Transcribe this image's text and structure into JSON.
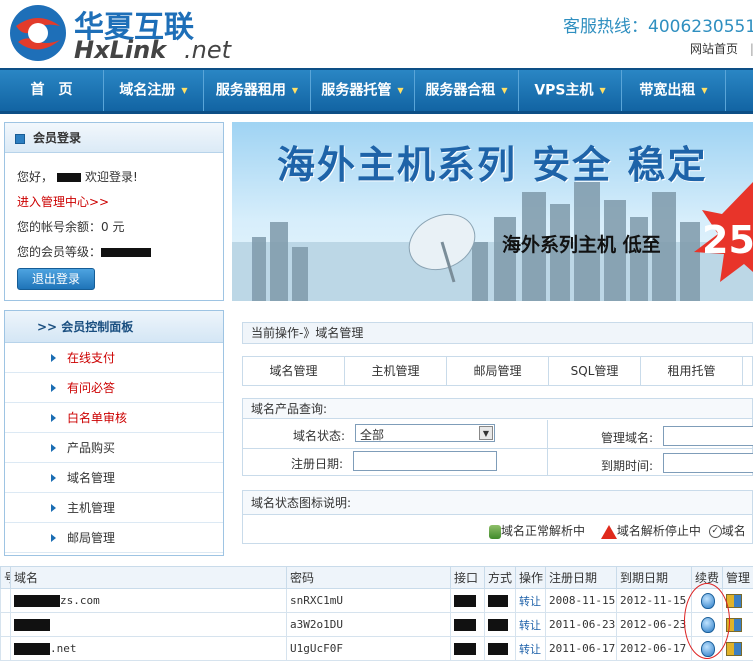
{
  "header": {
    "logo_cn": "华夏互联",
    "logo_en": "HxLink",
    "logo_tld": ".net",
    "hotline_label": "客服热线：4006230551",
    "hotline_tail": "(",
    "top_link": "网站首页",
    "top_sep": "|"
  },
  "nav": [
    {
      "label": "首　页",
      "dropdown": false
    },
    {
      "label": "域名注册",
      "dropdown": true
    },
    {
      "label": "服务器租用",
      "dropdown": true
    },
    {
      "label": "服务器托管",
      "dropdown": true
    },
    {
      "label": "服务器合租",
      "dropdown": true
    },
    {
      "label": "VPS主机",
      "dropdown": true
    },
    {
      "label": "带宽出租",
      "dropdown": true
    }
  ],
  "login": {
    "title": "会员登录",
    "greeting_prefix": "您好，",
    "greeting_suffix": "欢迎登录!",
    "manage_link": "进入管理中心>>",
    "balance": "您的帐号余额：0 元",
    "level_label": "您的会员等级：",
    "logout_button": "退出登录"
  },
  "banner": {
    "headline": "海外主机系列 安全 稳定",
    "subline": "海外系列主机 低至",
    "price": "25"
  },
  "panel": {
    "title": ">> 会员控制面板",
    "items": [
      {
        "label": "在线支付",
        "highlight": true
      },
      {
        "label": "有问必答",
        "highlight": true
      },
      {
        "label": "白名单审核",
        "highlight": true
      },
      {
        "label": "产品购买",
        "highlight": false
      },
      {
        "label": "域名管理",
        "highlight": false
      },
      {
        "label": "主机管理",
        "highlight": false
      },
      {
        "label": "邮局管理",
        "highlight": false
      }
    ]
  },
  "breadcrumb": "当前操作-》域名管理",
  "tabs": [
    "域名管理",
    "主机管理",
    "邮局管理",
    "SQL管理",
    "租用托管"
  ],
  "query": {
    "title": "域名产品查询:",
    "status_label": "域名状态:",
    "status_value": "全部",
    "manage_domain_label": "管理域名:",
    "reg_date_label": "注册日期:",
    "expire_label": "到期时间:"
  },
  "legend": {
    "title": "域名状态图标说明:",
    "items": [
      "域名正常解析中",
      "域名解析停止中",
      "域名"
    ]
  },
  "table": {
    "headers": [
      "号",
      "域名",
      "密码",
      "接口",
      "方式",
      "操作",
      "注册日期",
      "到期日期",
      "续费",
      "管理"
    ],
    "rows": [
      {
        "domain_suffix": "zs.com",
        "password": "snRXC1mU",
        "op": "转让",
        "reg": "2008-11-15",
        "exp": "2012-11-15"
      },
      {
        "domain_suffix": "",
        "password": "a3W2o1DU",
        "op": "转让",
        "reg": "2011-06-23",
        "exp": "2012-06-23"
      },
      {
        "domain_suffix": ".net",
        "password": "U1gUcF0F",
        "op": "转让",
        "reg": "2011-06-17",
        "exp": "2012-06-17"
      }
    ]
  },
  "colors": {
    "nav": "#1a72b5",
    "accent_red": "#cc0000",
    "link": "#1b5fa8"
  }
}
